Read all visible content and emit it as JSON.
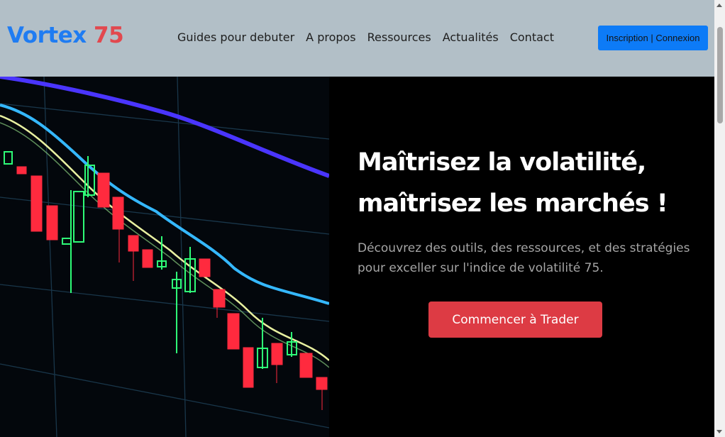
{
  "brand": {
    "name_part1": "Vortex",
    "name_part2": "75"
  },
  "nav": {
    "items": [
      {
        "label": "Guides pour debuter"
      },
      {
        "label": "A propos"
      },
      {
        "label": "Ressources"
      },
      {
        "label": "Actualités"
      },
      {
        "label": "Contact"
      }
    ]
  },
  "auth": {
    "label": "Inscription | Connexion"
  },
  "hero": {
    "headline_line1": "Maîtrisez la volatilité,",
    "headline_line2": "maîtrisez les marchés !",
    "subtext": "Découvrez des outils, des ressources, et des stratégies pour exceller sur l'indice de volatilité 75.",
    "cta_label": "Commencer à Trader",
    "image_label": "candlestick-chart-image"
  },
  "colors": {
    "header_bg": "#b2bfc7",
    "brand_blue": "#1f7cf2",
    "brand_red": "#e2484e",
    "auth_button": "#0d7bf7",
    "cta_button": "#dd3b44",
    "hero_bg": "#000000"
  }
}
